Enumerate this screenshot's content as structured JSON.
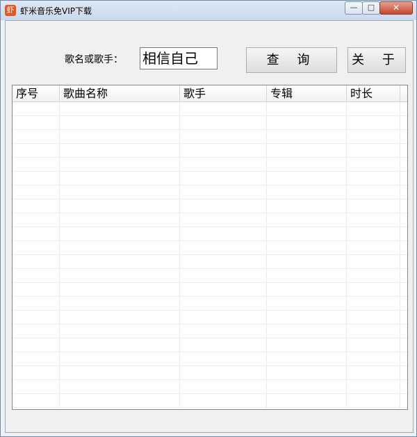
{
  "window": {
    "title": "虾米音乐免VIP下载",
    "icon_text": "虾"
  },
  "controls": {
    "min": "—",
    "max": "□",
    "close": "✕"
  },
  "search": {
    "label": "歌名或歌手：",
    "value": "相信自己"
  },
  "buttons": {
    "query": "查 询",
    "about": "关 于"
  },
  "table": {
    "columns": [
      "序号",
      "歌曲名称",
      "歌手",
      "专辑",
      "时长"
    ],
    "rows": []
  }
}
